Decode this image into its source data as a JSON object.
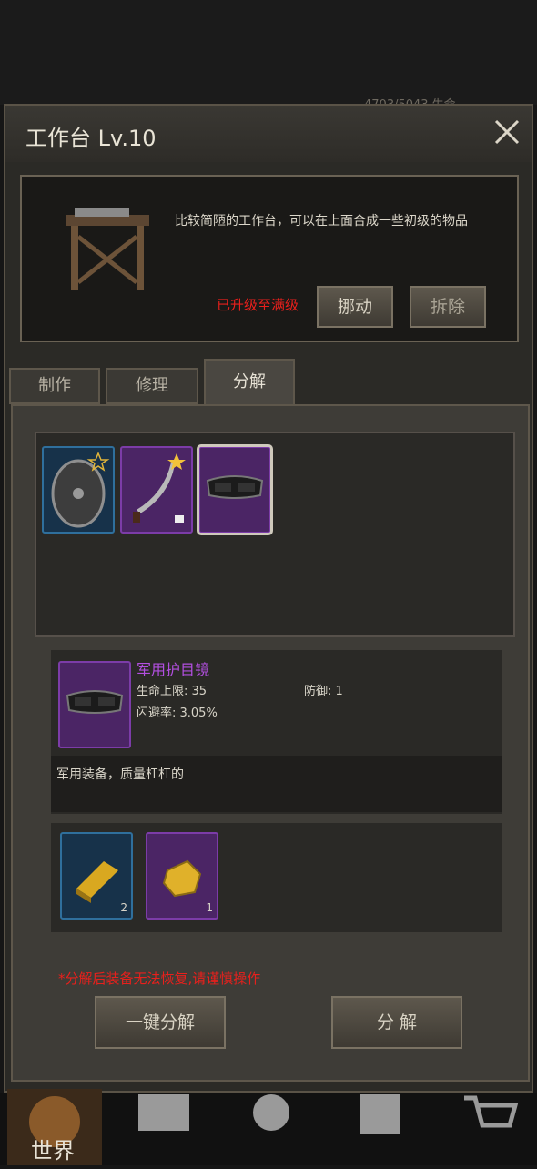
{
  "top_status": {
    "text": "4703/5043   生命"
  },
  "header": {
    "title": "工作台 Lv.10"
  },
  "workbench": {
    "description": "比较简陋的工作台，可以在上面合成一些初级的物品",
    "status": "已升级至满级",
    "move_label": "挪动",
    "dismantle_label": "拆除"
  },
  "tabs": [
    {
      "label": "制作",
      "active": false
    },
    {
      "label": "修理",
      "active": false
    },
    {
      "label": "分解",
      "active": true
    }
  ],
  "inventory": {
    "items": [
      {
        "name": "shield",
        "rarity": "blue",
        "starred": true,
        "locked": false
      },
      {
        "name": "sword",
        "rarity": "purple",
        "starred": true,
        "locked": true
      },
      {
        "name": "goggles",
        "rarity": "purple",
        "starred": false,
        "locked": false,
        "selected": true
      }
    ]
  },
  "selected_item": {
    "name": "军用护目镜",
    "stat1": "生命上限: 35",
    "stat2": "防御: 1",
    "stat3": "闪避率: 3.05%",
    "description": "军用装备，质量杠杠的"
  },
  "materials": [
    {
      "name": "gold-bar",
      "count": "2",
      "rarity": "blue"
    },
    {
      "name": "gold-ore",
      "count": "1",
      "rarity": "purple"
    }
  ],
  "warning": "*分解后装备无法恢复,请谨慎操作",
  "actions": {
    "one_click": "一键分解",
    "decompose": "分 解"
  },
  "bottom_nav": {
    "world_label": "世界"
  },
  "colors": {
    "rarity_blue": "#2f6f9c",
    "rarity_purple": "#7c3ca8",
    "warning": "#e8201c",
    "item_name": "#b34fe0"
  }
}
